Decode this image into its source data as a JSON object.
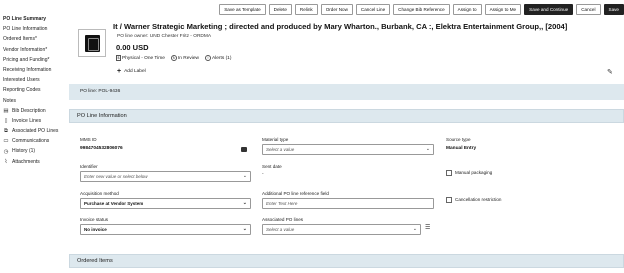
{
  "sidebar": {
    "items": [
      {
        "label": "PO Line Summary",
        "bold": true
      },
      {
        "label": "PO Line Information"
      },
      {
        "label": "Ordered Items*"
      },
      {
        "label": "Vendor Information*"
      },
      {
        "label": "Pricing and Funding*"
      },
      {
        "label": "Receiving Information"
      },
      {
        "label": "Interested Users"
      },
      {
        "label": "Reporting Codes"
      },
      {
        "label": "Notes"
      }
    ],
    "sub_items": [
      {
        "label": "Bib Description",
        "icon": "book-icon"
      },
      {
        "label": "Invoice Lines",
        "icon": "document-icon"
      },
      {
        "label": "Associated PO Lines",
        "icon": "link-icon"
      },
      {
        "label": "Communications",
        "icon": "chat-icon"
      },
      {
        "label": "History (1)",
        "icon": "history-icon"
      },
      {
        "label": "Attachments",
        "icon": "paperclip-icon"
      }
    ]
  },
  "toolbar": {
    "buttons": [
      {
        "label": "Save as Template"
      },
      {
        "label": "Delete"
      },
      {
        "label": "Relink"
      },
      {
        "label": "Order Now"
      },
      {
        "label": "Cancel Line"
      },
      {
        "label": "Change Bib Reference"
      },
      {
        "label": "Assign to"
      },
      {
        "label": "Assign to Me"
      },
      {
        "label": "Save and Continue",
        "dark": true
      },
      {
        "label": "Cancel"
      },
      {
        "label": "Save",
        "dark": true
      }
    ]
  },
  "header": {
    "title": "It / Warner Strategic Marketing ; directed and produced by Mary Wharton., Burbank, CA :, Elektra Entertainment Group,, [2004]",
    "owner": "PO line owner: UND Chester Fritz - ORDMA",
    "price": "0.00  USD",
    "type_label": "Physical - One Time",
    "status_label": "In Review",
    "alerts_label": "Alerts (1)",
    "add_label": "Add Label"
  },
  "po_line_bar": "PO line: POL-9436",
  "sections": {
    "po_line_information": "PO Line Information",
    "ordered_items": "Ordered Items"
  },
  "form": {
    "mms_id_label": "MMS ID",
    "mms_id_value": "9984704532806076",
    "identifier_label": "Identifier",
    "identifier_placeholder": "Enter new value or select below",
    "acquisition_label": "Acquisition method",
    "acquisition_value": "Purchase at Vendor System",
    "invoice_label": "Invoice status",
    "invoice_value": "No invoice",
    "material_label": "Material type",
    "material_value": "Select a value",
    "sent_date_label": "Sent date",
    "sent_date_value": "-",
    "additional_ref_label": "Additional PO line reference field",
    "additional_ref_placeholder": "Enter Text Here",
    "associated_label": "Associated PO lines",
    "associated_value": "Select a value",
    "source_type_label": "Source type",
    "source_type_value": "Manual Entry",
    "manual_packaging_label": "Manual packaging",
    "cancellation_label": "Cancellation restriction"
  }
}
